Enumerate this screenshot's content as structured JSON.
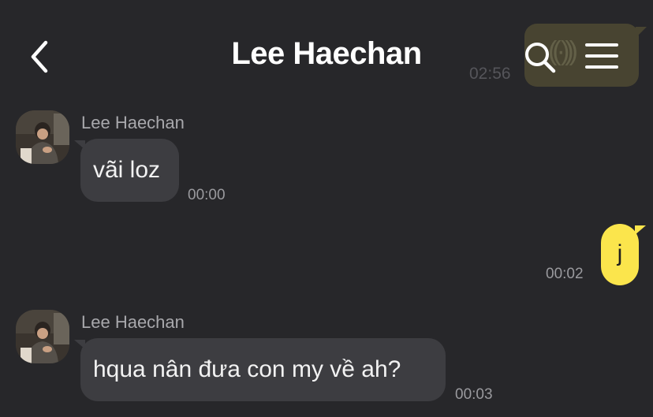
{
  "header": {
    "title": "Lee Haechan",
    "back_icon": "chevron-left-icon",
    "search_icon": "search-icon",
    "menu_icon": "hamburger-menu-icon"
  },
  "background_message": {
    "time": "02:56"
  },
  "messages": [
    {
      "direction": "incoming",
      "sender": "Lee Haechan",
      "text": "vãi loz",
      "time": "00:00"
    },
    {
      "direction": "outgoing",
      "text": "j",
      "time": "00:02"
    },
    {
      "direction": "incoming",
      "sender": "Lee Haechan",
      "text": "hqua nân đưa con my về ah?",
      "time": "00:03"
    }
  ],
  "colors": {
    "background": "#27272a",
    "incoming_bubble": "#3d3d41",
    "outgoing_bubble": "#fbe54c"
  }
}
